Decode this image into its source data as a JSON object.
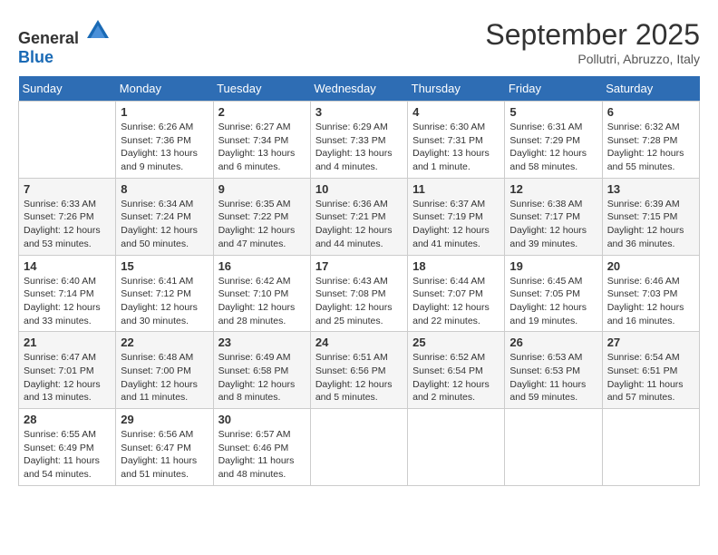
{
  "header": {
    "logo": {
      "general": "General",
      "blue": "Blue"
    },
    "title": "September 2025",
    "subtitle": "Pollutri, Abruzzo, Italy"
  },
  "weekdays": [
    "Sunday",
    "Monday",
    "Tuesday",
    "Wednesday",
    "Thursday",
    "Friday",
    "Saturday"
  ],
  "weeks": [
    [
      {
        "day": "",
        "info": ""
      },
      {
        "day": "1",
        "info": "Sunrise: 6:26 AM\nSunset: 7:36 PM\nDaylight: 13 hours\nand 9 minutes."
      },
      {
        "day": "2",
        "info": "Sunrise: 6:27 AM\nSunset: 7:34 PM\nDaylight: 13 hours\nand 6 minutes."
      },
      {
        "day": "3",
        "info": "Sunrise: 6:29 AM\nSunset: 7:33 PM\nDaylight: 13 hours\nand 4 minutes."
      },
      {
        "day": "4",
        "info": "Sunrise: 6:30 AM\nSunset: 7:31 PM\nDaylight: 13 hours\nand 1 minute."
      },
      {
        "day": "5",
        "info": "Sunrise: 6:31 AM\nSunset: 7:29 PM\nDaylight: 12 hours\nand 58 minutes."
      },
      {
        "day": "6",
        "info": "Sunrise: 6:32 AM\nSunset: 7:28 PM\nDaylight: 12 hours\nand 55 minutes."
      }
    ],
    [
      {
        "day": "7",
        "info": "Sunrise: 6:33 AM\nSunset: 7:26 PM\nDaylight: 12 hours\nand 53 minutes."
      },
      {
        "day": "8",
        "info": "Sunrise: 6:34 AM\nSunset: 7:24 PM\nDaylight: 12 hours\nand 50 minutes."
      },
      {
        "day": "9",
        "info": "Sunrise: 6:35 AM\nSunset: 7:22 PM\nDaylight: 12 hours\nand 47 minutes."
      },
      {
        "day": "10",
        "info": "Sunrise: 6:36 AM\nSunset: 7:21 PM\nDaylight: 12 hours\nand 44 minutes."
      },
      {
        "day": "11",
        "info": "Sunrise: 6:37 AM\nSunset: 7:19 PM\nDaylight: 12 hours\nand 41 minutes."
      },
      {
        "day": "12",
        "info": "Sunrise: 6:38 AM\nSunset: 7:17 PM\nDaylight: 12 hours\nand 39 minutes."
      },
      {
        "day": "13",
        "info": "Sunrise: 6:39 AM\nSunset: 7:15 PM\nDaylight: 12 hours\nand 36 minutes."
      }
    ],
    [
      {
        "day": "14",
        "info": "Sunrise: 6:40 AM\nSunset: 7:14 PM\nDaylight: 12 hours\nand 33 minutes."
      },
      {
        "day": "15",
        "info": "Sunrise: 6:41 AM\nSunset: 7:12 PM\nDaylight: 12 hours\nand 30 minutes."
      },
      {
        "day": "16",
        "info": "Sunrise: 6:42 AM\nSunset: 7:10 PM\nDaylight: 12 hours\nand 28 minutes."
      },
      {
        "day": "17",
        "info": "Sunrise: 6:43 AM\nSunset: 7:08 PM\nDaylight: 12 hours\nand 25 minutes."
      },
      {
        "day": "18",
        "info": "Sunrise: 6:44 AM\nSunset: 7:07 PM\nDaylight: 12 hours\nand 22 minutes."
      },
      {
        "day": "19",
        "info": "Sunrise: 6:45 AM\nSunset: 7:05 PM\nDaylight: 12 hours\nand 19 minutes."
      },
      {
        "day": "20",
        "info": "Sunrise: 6:46 AM\nSunset: 7:03 PM\nDaylight: 12 hours\nand 16 minutes."
      }
    ],
    [
      {
        "day": "21",
        "info": "Sunrise: 6:47 AM\nSunset: 7:01 PM\nDaylight: 12 hours\nand 13 minutes."
      },
      {
        "day": "22",
        "info": "Sunrise: 6:48 AM\nSunset: 7:00 PM\nDaylight: 12 hours\nand 11 minutes."
      },
      {
        "day": "23",
        "info": "Sunrise: 6:49 AM\nSunset: 6:58 PM\nDaylight: 12 hours\nand 8 minutes."
      },
      {
        "day": "24",
        "info": "Sunrise: 6:51 AM\nSunset: 6:56 PM\nDaylight: 12 hours\nand 5 minutes."
      },
      {
        "day": "25",
        "info": "Sunrise: 6:52 AM\nSunset: 6:54 PM\nDaylight: 12 hours\nand 2 minutes."
      },
      {
        "day": "26",
        "info": "Sunrise: 6:53 AM\nSunset: 6:53 PM\nDaylight: 11 hours\nand 59 minutes."
      },
      {
        "day": "27",
        "info": "Sunrise: 6:54 AM\nSunset: 6:51 PM\nDaylight: 11 hours\nand 57 minutes."
      }
    ],
    [
      {
        "day": "28",
        "info": "Sunrise: 6:55 AM\nSunset: 6:49 PM\nDaylight: 11 hours\nand 54 minutes."
      },
      {
        "day": "29",
        "info": "Sunrise: 6:56 AM\nSunset: 6:47 PM\nDaylight: 11 hours\nand 51 minutes."
      },
      {
        "day": "30",
        "info": "Sunrise: 6:57 AM\nSunset: 6:46 PM\nDaylight: 11 hours\nand 48 minutes."
      },
      {
        "day": "",
        "info": ""
      },
      {
        "day": "",
        "info": ""
      },
      {
        "day": "",
        "info": ""
      },
      {
        "day": "",
        "info": ""
      }
    ]
  ]
}
